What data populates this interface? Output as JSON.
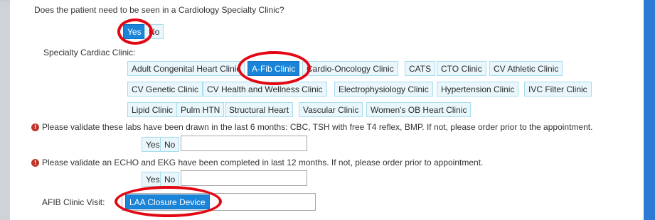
{
  "q_cardiology": {
    "question": "Does the patient need to be seen in a Cardiology Specialty Clinic?",
    "yes": "Yes",
    "no": "No"
  },
  "specialty": {
    "label": "Specialty Cardiac Clinic:",
    "clinics": [
      "Adult Congenital Heart Clinic",
      "A-Fib Clinic",
      "Cardio-Oncology Clinic",
      "CATS",
      "CTO Clinic",
      "CV Athletic Clinic",
      "CV Genetic Clinic",
      "CV Health and Wellness Clinic",
      "Electrophysiology Clinic",
      "Hypertension Clinic",
      "IVC Filter Clinic",
      "Lipid Clinic",
      "Pulm HTN",
      "Structural Heart",
      "Vascular Clinic",
      "Women's OB Heart Clinic"
    ],
    "selected": "A-Fib Clinic"
  },
  "labs": {
    "warning": "Please validate these labs have been drawn in the last 6 months: CBC, TSH with free T4 reflex, BMP. If not, please order prior to the appointment.",
    "yes": "Yes",
    "no": "No",
    "comment_value": ""
  },
  "echo": {
    "warning": "Please validate an ECHO and EKG have been completed in last 12 months. If not, please order prior to appointment.",
    "yes": "Yes",
    "no": "No",
    "comment_value": ""
  },
  "afib_visit": {
    "label": "AFIB Clinic Visit:",
    "selected": "LAA Closure Device"
  },
  "icons": {
    "warning": "exclamation-circle-icon"
  },
  "colors": {
    "selected": "#1a84d8",
    "option_bg": "#e9f7fc",
    "annotation": "#e30613",
    "warning": "#c03429"
  }
}
